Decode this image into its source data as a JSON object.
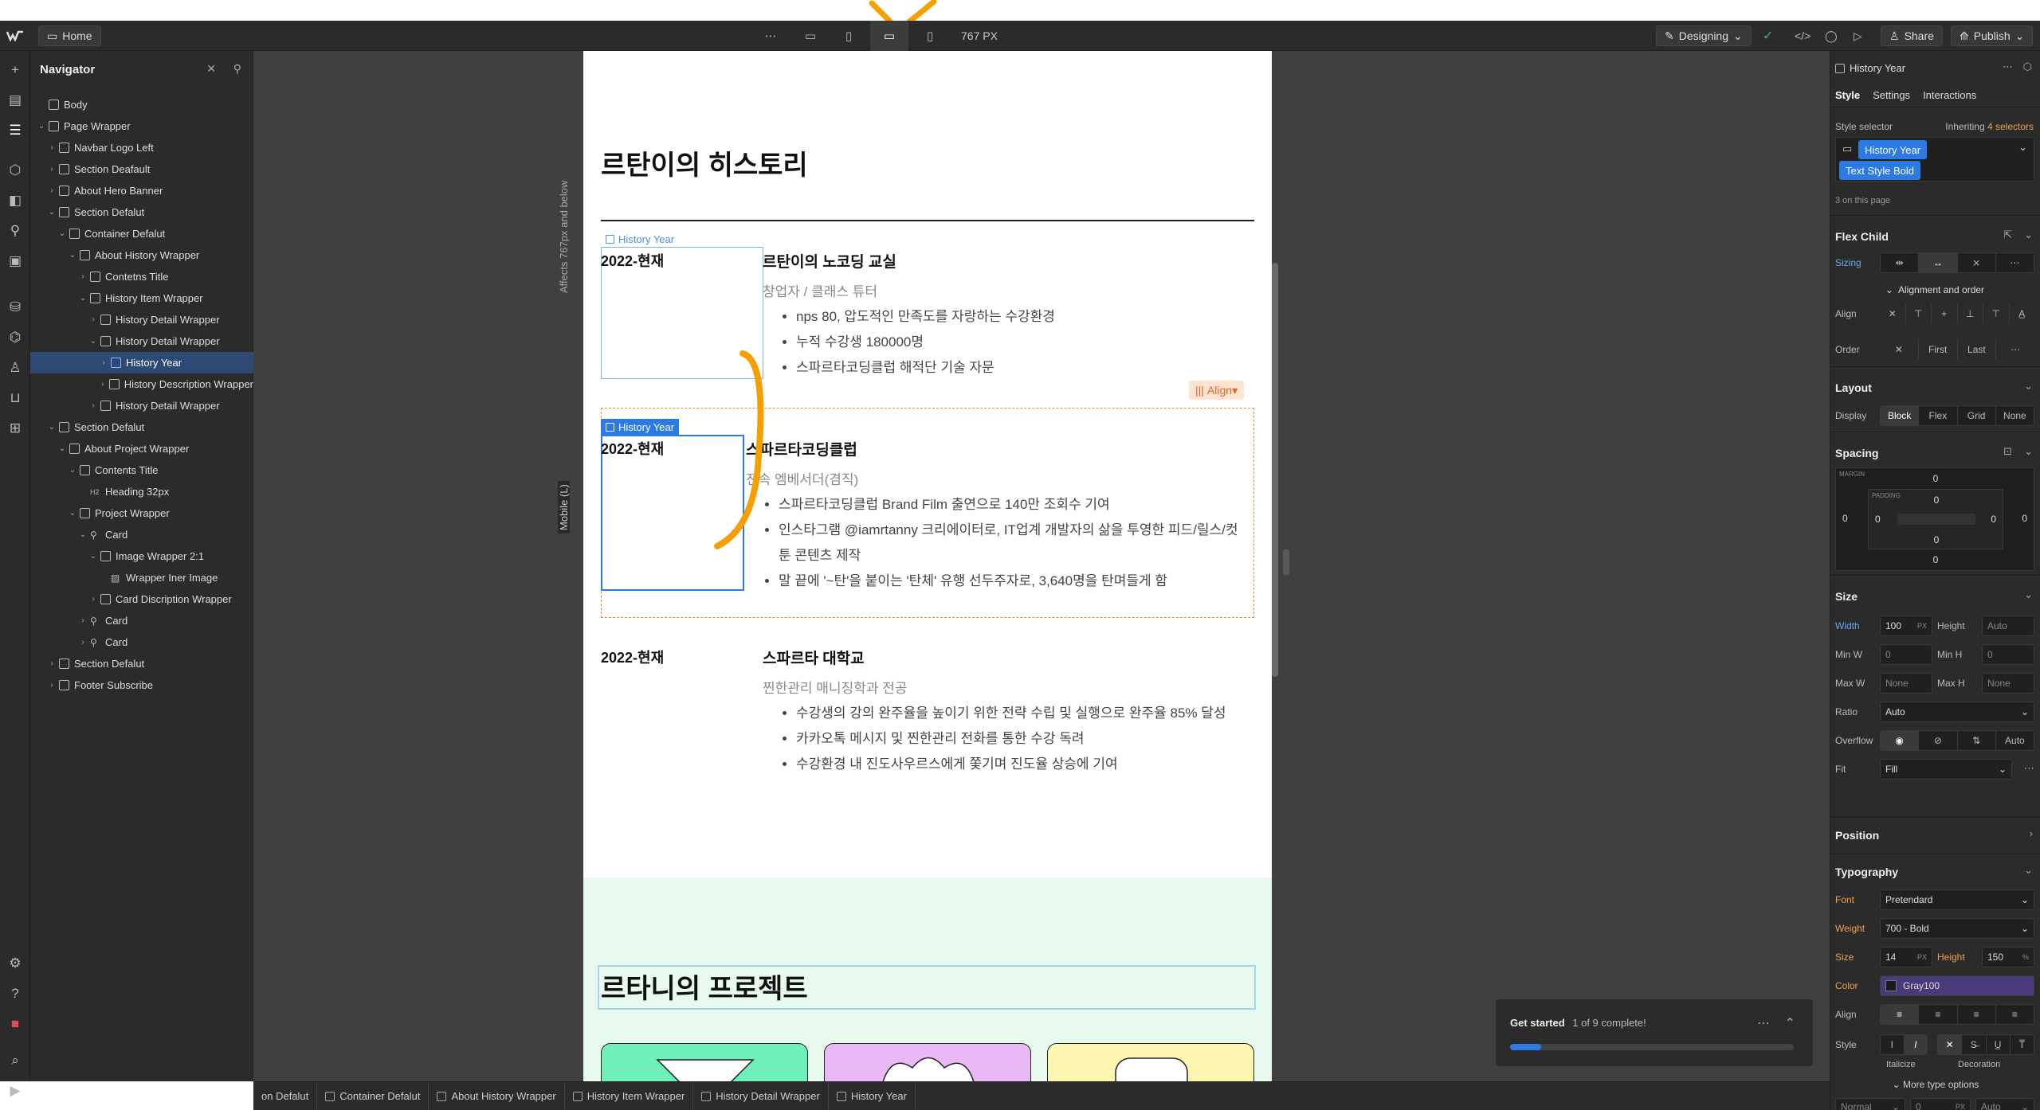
{
  "topbar": {
    "home": "Home",
    "width_readout": "767 PX",
    "mode": "Designing",
    "share": "Share",
    "publish": "Publish"
  },
  "navigator": {
    "title": "Navigator",
    "items": [
      {
        "label": "Body",
        "depth": 0,
        "chev": ""
      },
      {
        "label": "Page Wrapper",
        "depth": 0,
        "chev": "⌄"
      },
      {
        "label": "Navbar Logo Left",
        "depth": 1,
        "chev": "›"
      },
      {
        "label": "Section Deafault",
        "depth": 1,
        "chev": "›"
      },
      {
        "label": "About Hero Banner",
        "depth": 1,
        "chev": "›"
      },
      {
        "label": "Section Defalut",
        "depth": 1,
        "chev": "⌄"
      },
      {
        "label": "Container Defalut",
        "depth": 2,
        "chev": "⌄"
      },
      {
        "label": "About History Wrapper",
        "depth": 3,
        "chev": "⌄"
      },
      {
        "label": "Contetns Title",
        "depth": 4,
        "chev": "›"
      },
      {
        "label": "History Item Wrapper",
        "depth": 4,
        "chev": "⌄"
      },
      {
        "label": "History Detail Wrapper",
        "depth": 5,
        "chev": "›"
      },
      {
        "label": "History Detail Wrapper",
        "depth": 5,
        "chev": "⌄"
      },
      {
        "label": "History Year",
        "depth": 6,
        "chev": "›",
        "selected": true
      },
      {
        "label": "History Description Wrapper",
        "depth": 6,
        "chev": "›"
      },
      {
        "label": "History Detail Wrapper",
        "depth": 5,
        "chev": "›"
      },
      {
        "label": "Section Defalut",
        "depth": 1,
        "chev": "⌄"
      },
      {
        "label": "About Project Wrapper",
        "depth": 2,
        "chev": "⌄"
      },
      {
        "label": "Contents Title",
        "depth": 3,
        "chev": "⌄"
      },
      {
        "label": "Heading 32px",
        "depth": 4,
        "chev": "",
        "h2": true
      },
      {
        "label": "Project Wrapper",
        "depth": 3,
        "chev": "⌄"
      },
      {
        "label": "Card",
        "depth": 4,
        "chev": "⌄",
        "link": true
      },
      {
        "label": "Image Wrapper 2:1",
        "depth": 5,
        "chev": "⌄"
      },
      {
        "label": "Wrapper Iner Image",
        "depth": 6,
        "chev": "",
        "image": true
      },
      {
        "label": "Card Discription Wrapper",
        "depth": 5,
        "chev": "›"
      },
      {
        "label": "Card",
        "depth": 4,
        "chev": "›",
        "link": true
      },
      {
        "label": "Card",
        "depth": 4,
        "chev": "›",
        "link": true
      },
      {
        "label": "Section Defalut",
        "depth": 1,
        "chev": "›"
      },
      {
        "label": "Footer Subscribe",
        "depth": 1,
        "chev": "›"
      }
    ]
  },
  "canvas": {
    "history_heading": "르탄이의 히스토리",
    "side_note": "Affects 767px and below",
    "side_badge": "Mobile (L)",
    "sel_label": "History Year",
    "align_label": "Align",
    "entries": [
      {
        "year": "2022-현재",
        "title": "르탄이의 노코딩 교실",
        "role": "창업자 / 클래스 튜터",
        "bullets": [
          "nps 80, 압도적인 만족도를 자랑하는 수강환경",
          "누적 수강생 180000명",
          "스파르타코딩클럽 해적단 기술 자문"
        ]
      },
      {
        "year": "2022-현재",
        "title": "스파르타코딩클럽",
        "role": "전속 엠베서더(겸직)",
        "bullets": [
          "스파르타코딩클럽 Brand Film 출연으로 140만 조회수 기여",
          "인스타그램 @iamrtanny 크리에이터로, IT업계 개발자의 삶을 투영한 피드/릴스/컷툰 콘텐츠 제작",
          "말 끝에 '~탄'을 붙이는 '탄체' 유행 선두주자로, 3,640명을 탄며들게 함"
        ]
      },
      {
        "year": "2022-현재",
        "title": "스파르타 대학교",
        "role": "찐한관리 매니징학과 전공",
        "bullets": [
          "수강생의 강의 완주율을 높이기 위한 전략 수립 및 실행으로 완주율 85% 달성",
          "카카오톡 메시지 및 찐한관리 전화를 통한 수강 독려",
          "수강환경 내 진도사우르스에게 쫓기며 진도율 상승에 기여"
        ]
      }
    ],
    "project_heading": "르타니의 프로젝트"
  },
  "right_panel": {
    "element_name": "History Year",
    "tabs": [
      "Style",
      "Settings",
      "Interactions"
    ],
    "style_selector_label": "Style selector",
    "inheriting": "Inheriting",
    "selectors_count": "4 selectors",
    "class_primary": "History Year",
    "class_secondary": "Text Style Bold",
    "on_page": "3 on this page",
    "flex_child": "Flex Child",
    "sizing": "Sizing",
    "alignment_order": "Alignment and order",
    "align": "Align",
    "order": "Order",
    "order_opts": [
      "First",
      "Last"
    ],
    "layout": "Layout",
    "display": "Display",
    "display_opts": [
      "Block",
      "Flex",
      "Grid",
      "None"
    ],
    "spacing": "Spacing",
    "margin": "MARGIN",
    "padding": "PADDING",
    "size": "Size",
    "width_label": "Width",
    "width_val": "100",
    "width_unit": "PX",
    "height_label": "Height",
    "height_val": "Auto",
    "minw": "Min W",
    "minw_val": "0",
    "minh": "Min H",
    "minh_val": "0",
    "maxw": "Max W",
    "maxw_val": "None",
    "maxh": "Max H",
    "maxh_val": "None",
    "ratio": "Ratio",
    "ratio_val": "Auto",
    "overflow": "Overflow",
    "overflow_auto": "Auto",
    "fit": "Fit",
    "fit_val": "Fill",
    "position": "Position",
    "typography": "Typography",
    "font": "Font",
    "font_val": "Pretendard",
    "weight": "Weight",
    "weight_val": "700 - Bold",
    "size_lbl": "Size",
    "size_val": "14",
    "line_height_lbl": "Height",
    "line_height_val": "150",
    "color": "Color",
    "color_val": "Gray100",
    "talign": "Align",
    "tstyle": "Style",
    "italicize": "Italicize",
    "decoration": "Decoration",
    "more_type": "More type options",
    "normal": "Normal",
    "zero": "0",
    "auto": "Auto"
  },
  "breadcrumbs": [
    "on Defalut",
    "Container Defalut",
    "About History Wrapper",
    "History Item Wrapper",
    "History Detail Wrapper",
    "History Year"
  ],
  "toast": {
    "title": "Get started",
    "progress_text": "1 of 9 complete!",
    "progress": 0.11
  },
  "colors": {
    "accent": "#2c7be5",
    "orange": "#f5a000",
    "panel": "#2b2b2b"
  }
}
